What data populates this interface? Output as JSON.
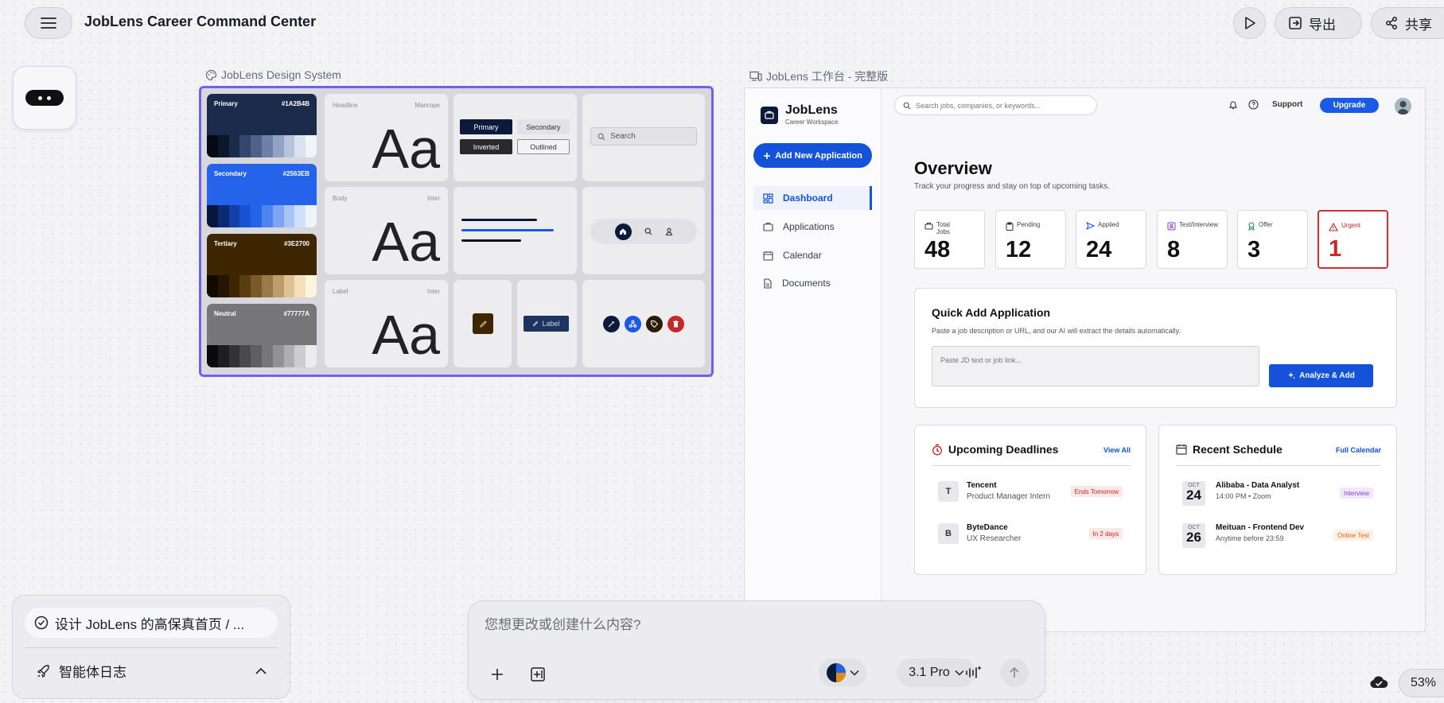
{
  "app": {
    "title": "JobLens Career Command Center"
  },
  "toolbar": {
    "export_label": "导出",
    "share_label": "共享"
  },
  "frames": {
    "design_system_label": "JobLens Design System",
    "workspace_label": "JobLens 工作台 - 完整版"
  },
  "design_system": {
    "swatches": [
      {
        "name": "Primary",
        "hex": "#1A2B4B",
        "color": "#1a2b4b",
        "shades": [
          "#050a14",
          "#0d172b",
          "#1a2b4b",
          "#33466b",
          "#4e6189",
          "#6e80a6",
          "#92a2c3",
          "#b8c4dc",
          "#dbe2ef",
          "#f1f4fa"
        ]
      },
      {
        "name": "Secondary",
        "hex": "#2563EB",
        "color": "#2563eb",
        "shades": [
          "#06163d",
          "#0b2a74",
          "#133fa8",
          "#1a52cf",
          "#2563eb",
          "#4f84f0",
          "#7ea5f5",
          "#a9c4f8",
          "#d1e0fc",
          "#eef4fe"
        ]
      },
      {
        "name": "Tertiary",
        "hex": "#3E2700",
        "color": "#3e2700",
        "shades": [
          "#110a00",
          "#241600",
          "#3e2700",
          "#5a3d10",
          "#7a5a2a",
          "#9c7a48",
          "#c09c6a",
          "#dfc294",
          "#f5dfbb",
          "#fff4e0"
        ]
      },
      {
        "name": "Neutral",
        "hex": "#77777A",
        "color": "#77777a",
        "shades": [
          "#0a0a0b",
          "#1e1e20",
          "#333336",
          "#4a4a4d",
          "#5f5f62",
          "#77777a",
          "#929295",
          "#afafb2",
          "#cdcdd0",
          "#ececee"
        ]
      }
    ],
    "typography": [
      {
        "role": "Headline",
        "font": "Manrope",
        "sample": "Aa"
      },
      {
        "role": "Body",
        "font": "Inter",
        "sample": "Aa"
      },
      {
        "role": "Label",
        "font": "Inter",
        "sample": "Aa"
      }
    ],
    "buttons": {
      "primary": "Primary",
      "secondary": "Secondary",
      "inverted": "Inverted",
      "outlined": "Outlined"
    },
    "search_placeholder": "Search",
    "chip_label": "Label"
  },
  "workspace": {
    "brand": {
      "name": "JobLens",
      "sub": "Career Workspace"
    },
    "add_button": "Add New Application",
    "nav": [
      {
        "label": "Dashboard",
        "icon": "dashboard-icon",
        "active": true
      },
      {
        "label": "Applications",
        "icon": "briefcase-icon",
        "active": false
      },
      {
        "label": "Calendar",
        "icon": "calendar-icon",
        "active": false
      },
      {
        "label": "Documents",
        "icon": "document-icon",
        "active": false
      }
    ],
    "search_placeholder": "Search jobs, companies, or keywords...",
    "support": "Support",
    "upgrade": "Upgrade",
    "overview": {
      "title": "Overview",
      "subtitle": "Track your progress and stay on top of upcoming tasks."
    },
    "stats": [
      {
        "label": "Total Jobs",
        "value": "48",
        "color": "#333333"
      },
      {
        "label": "Pending",
        "value": "12",
        "color": "#333333"
      },
      {
        "label": "Applied",
        "value": "24",
        "color": "#1453d9"
      },
      {
        "label": "Test/Interview",
        "value": "8",
        "color": "#8b3fc7"
      },
      {
        "label": "Offer",
        "value": "3",
        "color": "#1b8a4a"
      },
      {
        "label": "Urgent",
        "value": "1",
        "color": "#d32f2f"
      }
    ],
    "quick_add": {
      "title": "Quick Add Application",
      "subtitle": "Paste a job description or URL, and our AI will extract the details automatically.",
      "placeholder": "Paste JD text or job link...",
      "button": "Analyze & Add"
    },
    "deadlines": {
      "title": "Upcoming Deadlines",
      "link": "View All",
      "items": [
        {
          "letter": "T",
          "company": "Tencent",
          "role": "Product Manager Intern",
          "tag": "Ends Tomorrow"
        },
        {
          "letter": "B",
          "company": "ByteDance",
          "role": "UX Researcher",
          "tag": "In 2 days"
        }
      ]
    },
    "schedule": {
      "title": "Recent Schedule",
      "link": "Full Calendar",
      "items": [
        {
          "month": "OCT",
          "day": "24",
          "title": "Alibaba - Data Analyst",
          "time": "14:00 PM • Zoom",
          "tag": "Interview"
        },
        {
          "month": "OCT",
          "day": "26",
          "title": "Meituan - Frontend Dev",
          "time": "Anytime before 23:59",
          "tag": "Online Test"
        }
      ]
    }
  },
  "task": {
    "title": "设计 JobLens 的高保真首页 / ...",
    "log_label": "智能体日志"
  },
  "prompt": {
    "placeholder": "您想更改或创建什么内容?",
    "model": "3.1 Pro"
  },
  "zoom": "53%"
}
